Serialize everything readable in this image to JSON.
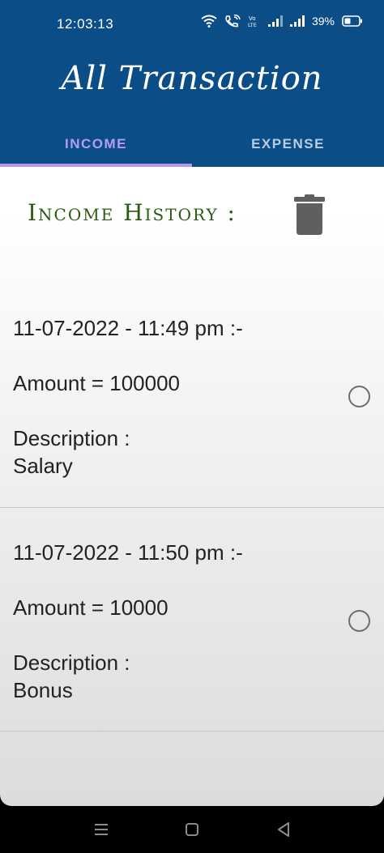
{
  "status_bar": {
    "time": "12:03:13",
    "icons": [
      "wifi-icon",
      "wifi-call-icon",
      "volte-icon",
      "signal-1-icon",
      "signal-2-icon",
      "battery-icon"
    ],
    "battery": "39%"
  },
  "header": {
    "title": "All Transaction",
    "color": "#0b4d87"
  },
  "tabs": [
    {
      "label": "INCOME",
      "selected": true,
      "color": "#b59cf0"
    },
    {
      "label": "EXPENSE",
      "selected": false,
      "color": "#b9cde2"
    }
  ],
  "main": {
    "history_title": "Income History :",
    "delete_icon": "trash-icon",
    "transactions": [
      {
        "date": "11-07-2022 - 11:49 pm :-",
        "amount": "Amount = 100000",
        "description_label": "Description :",
        "description": "Salary",
        "selected": false
      },
      {
        "date": "11-07-2022 - 11:50 pm :-",
        "amount": "Amount = 10000",
        "description_label": "Description :",
        "description": "Bonus",
        "selected": false
      }
    ]
  },
  "nav_bar": {
    "buttons": [
      "menu-icon",
      "home-icon",
      "back-icon"
    ]
  }
}
